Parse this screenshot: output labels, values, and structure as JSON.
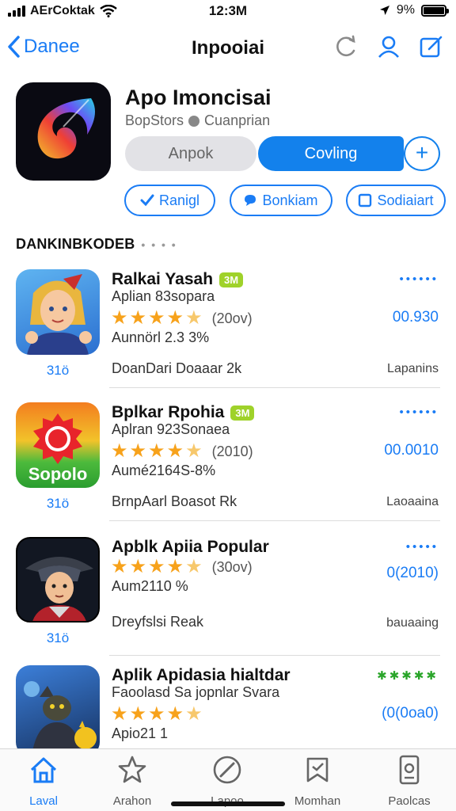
{
  "status_bar": {
    "carrier": "AErCoktak",
    "time": "12:3M",
    "battery": "9%"
  },
  "nav": {
    "back_label": "Danee",
    "title": "Inpooiai",
    "icons": [
      "refresh-icon",
      "person-icon",
      "compose-icon"
    ]
  },
  "app": {
    "name": "Apo Imoncisai",
    "store": "BopStors",
    "developer": "Cuanprian",
    "button_gray": "Anpok",
    "button_blue": "Covling",
    "button_plus": "+",
    "pills": [
      {
        "label": "Ranigl",
        "icon": "check-icon"
      },
      {
        "label": "Bonkiam",
        "icon": "speech-bubble-icon"
      },
      {
        "label": "Sodiaiart",
        "icon": "square-icon"
      }
    ]
  },
  "section": {
    "title": "DANKINBKODEB",
    "dots": "• • • •"
  },
  "list": [
    {
      "title": "Ralkai Yasah",
      "badge": "3M",
      "subtitle": "Aplian 83sopara",
      "rating": 4.5,
      "rating_count": "(20ov)",
      "info": "Aunnörl 2.3 3%",
      "developer": "DoanDari Doaaar 2k",
      "rank": "31ö",
      "right_dots": "••••••",
      "price": "00.930",
      "category": "Lapanins"
    },
    {
      "title": "Bplkar Rpohia",
      "badge": "3M",
      "subtitle": "Aplran 923Sonaea",
      "rating": 4.5,
      "rating_count": "(2010)",
      "info": "Aumé2164S-8%",
      "developer": "BrnpAarl Boasot Rk",
      "rank": "31ö",
      "right_dots": "••••••",
      "price": "00.0010",
      "category": "Laoaaina"
    },
    {
      "title": "Apblk Apiia Popular",
      "badge": "",
      "subtitle": "",
      "rating": 4.5,
      "rating_count": "(30ov)",
      "info": "Aum2110  %",
      "developer": "Dreyfslsi Reak",
      "rank": "31ö",
      "right_dots": "•••••",
      "price": "0(2010)",
      "category": "bauaaing"
    },
    {
      "title": "Aplik Apidasia hialtdar",
      "badge": "",
      "subtitle": "Faoolasd Sa jopnlar Svara",
      "rating": 4.5,
      "rating_count": "",
      "info": "Apio21 1",
      "developer": "",
      "rank": "",
      "right_dots": "✱✱✱✱✱",
      "price": "(0(0oa0)",
      "category": ""
    }
  ],
  "tabs": [
    {
      "label": "Laval",
      "icon": "home-icon",
      "active": true
    },
    {
      "label": "Arahon",
      "icon": "star-icon",
      "active": false
    },
    {
      "label": "Lapoo",
      "icon": "compass-icon",
      "active": false
    },
    {
      "label": "Momhan",
      "icon": "bookmark-icon",
      "active": false
    },
    {
      "label": "Paolcas",
      "icon": "phone-icon",
      "active": false
    }
  ],
  "colors": {
    "accent": "#1a7cf5",
    "button_blue": "#1381ec",
    "star": "#f7a21b",
    "badge": "#9fd22a"
  }
}
